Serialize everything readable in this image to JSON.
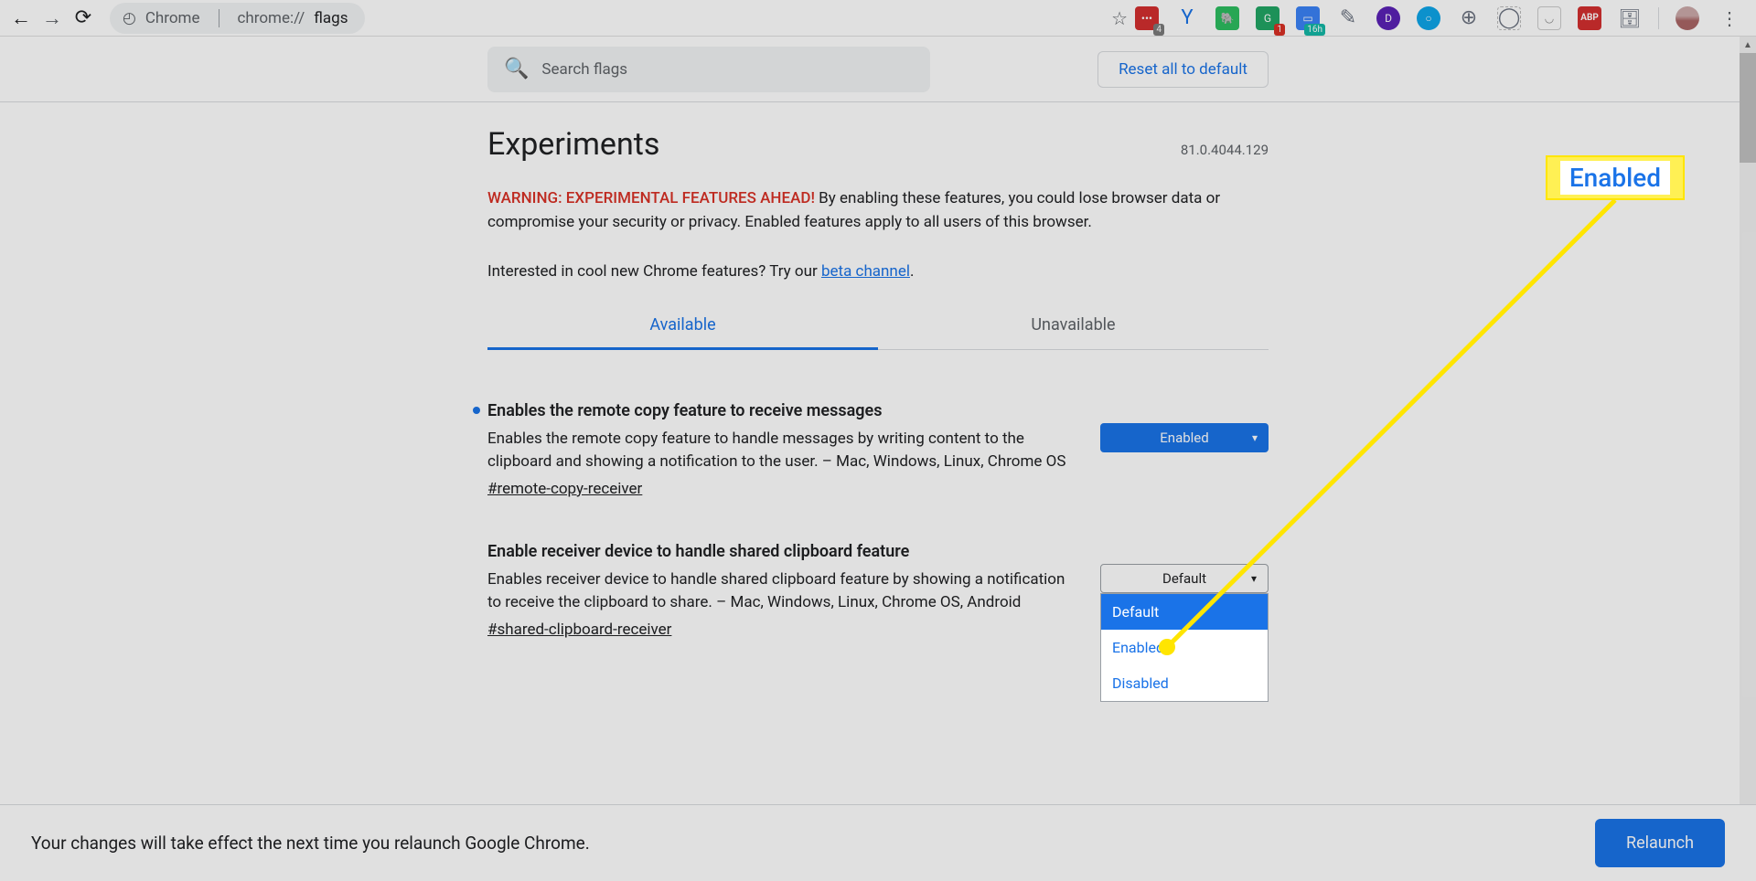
{
  "browser": {
    "title_label": "Chrome",
    "url_prefix": "chrome://",
    "url_highlight": "flags",
    "extension_badges": {
      "lastpass_count": "4",
      "grammarly_count": "1",
      "teal_badge": "16h"
    }
  },
  "header": {
    "search_placeholder": "Search flags",
    "reset_label": "Reset all to default"
  },
  "page": {
    "title": "Experiments",
    "version": "81.0.4044.129",
    "warning_prefix": "WARNING: EXPERIMENTAL FEATURES AHEAD!",
    "warning_rest": " By enabling these features, you could lose browser data or compromise your security or privacy. Enabled features apply to all users of this browser.",
    "interested_text": "Interested in cool new Chrome features? Try our ",
    "beta_link_text": "beta channel",
    "interested_suffix": "."
  },
  "tabs": {
    "available": "Available",
    "unavailable": "Unavailable"
  },
  "flags": [
    {
      "title": "Enables the remote copy feature to receive messages",
      "desc": "Enables the remote copy feature to handle messages by writing content to the clipboard and showing a notification to the user. – Mac, Windows, Linux, Chrome OS",
      "hash": "#remote-copy-receiver",
      "value": "Enabled",
      "modified": true
    },
    {
      "title": "Enable receiver device to handle shared clipboard feature",
      "desc": "Enables receiver device to handle shared clipboard feature by showing a notification to receive the clipboard to share. – Mac, Windows, Linux, Chrome OS, Android",
      "hash": "#shared-clipboard-receiver",
      "value": "Default",
      "modified": false
    }
  ],
  "dropdown": {
    "options": [
      "Default",
      "Enabled",
      "Disabled"
    ],
    "selected": "Default"
  },
  "relaunch": {
    "message": "Your changes will take effect the next time you relaunch Google Chrome.",
    "button": "Relaunch"
  },
  "callout": {
    "label": "Enabled"
  }
}
